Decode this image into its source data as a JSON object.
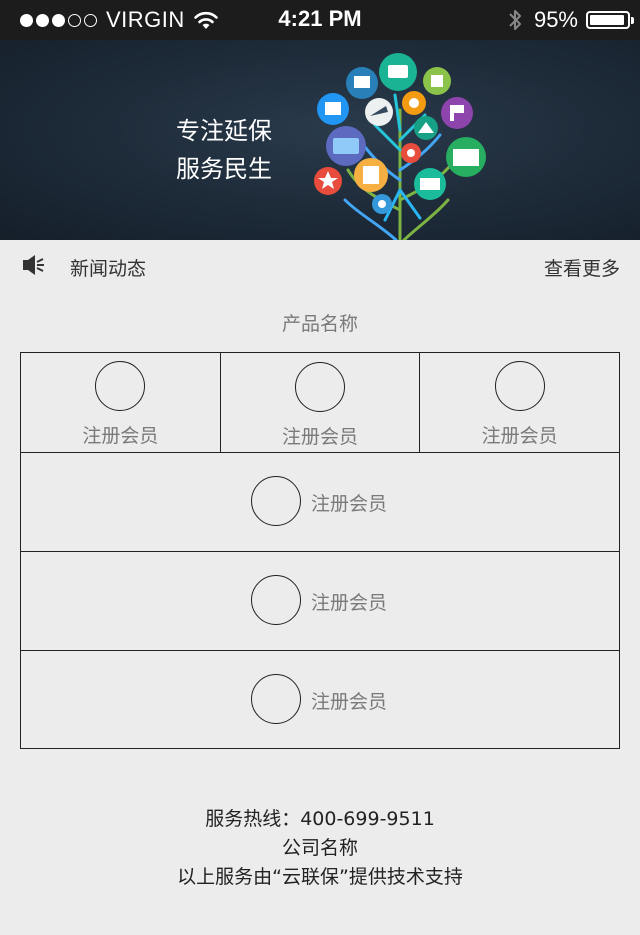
{
  "status_bar": {
    "carrier": "VIRGIN",
    "time": "4:21 PM",
    "battery": "95%",
    "battery_level": 0.95,
    "signal_filled": 3,
    "signal_total": 5
  },
  "banner": {
    "line1": "专注延保",
    "line2": "服务民生",
    "art_icon": "tree-of-service-icons"
  },
  "news": {
    "icon": "speaker-icon",
    "label": "新闻动态",
    "more": "查看更多"
  },
  "product": {
    "title": "产品名称",
    "top_cells": [
      {
        "label": "注册会员"
      },
      {
        "label": "注册会员"
      },
      {
        "label": "注册会员"
      }
    ],
    "rows": [
      {
        "label": "注册会员"
      },
      {
        "label": "注册会员"
      },
      {
        "label": "注册会员"
      }
    ]
  },
  "footer": {
    "hotline": "服务热线：400-699-9511",
    "company": "公司名称",
    "support": "以上服务由“云联保”提供技术支持"
  },
  "colors": {
    "background": "#ececec",
    "status_bar": "#1c1c1c",
    "banner": "#1d2a38",
    "muted_text": "#7a7a7a",
    "border": "#222222"
  }
}
